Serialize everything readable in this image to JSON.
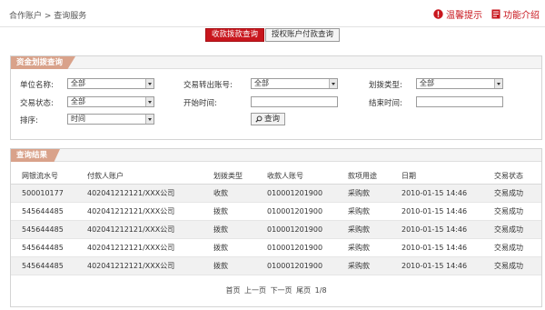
{
  "breadcrumb": {
    "text": "合作账户 > 查询服务"
  },
  "top_links": [
    {
      "label": "温馨提示",
      "icon": "alert-icon"
    },
    {
      "label": "功能介绍",
      "icon": "document-icon"
    }
  ],
  "tabs": [
    {
      "label": "收款拨款查询",
      "active": true
    },
    {
      "label": "授权账户付款查询",
      "active": false
    }
  ],
  "query_panel": {
    "title": "资金划拨查询",
    "unit_name_label": "单位名称:",
    "unit_name_value": "全部",
    "out_account_label": "交易转出账号:",
    "out_account_value": "全部",
    "transfer_type_label": "划拨类型:",
    "transfer_type_value": "全部",
    "status_label": "交易状态:",
    "status_value": "全部",
    "start_time_label": "开始时间:",
    "start_time_value": "",
    "end_time_label": "结束时间:",
    "end_time_value": "",
    "sort_label": "排序:",
    "sort_value": "时间",
    "query_button": "查询"
  },
  "results": {
    "title": "查询结果",
    "columns": [
      "网银流水号",
      "付款人账户",
      "划拨类型",
      "收款人账号",
      "款项用途",
      "日期",
      "交易状态"
    ],
    "rows": [
      [
        "500010177",
        "402041212121/XXX公司",
        "收款",
        "010001201900",
        "采购款",
        "2010-01-15 14:46",
        "交易成功"
      ],
      [
        "545644485",
        "402041212121/XXX公司",
        "拨款",
        "010001201900",
        "采购款",
        "2010-01-15 14:46",
        "交易成功"
      ],
      [
        "545644485",
        "402041212121/XXX公司",
        "拨款",
        "010001201900",
        "采购款",
        "2010-01-15 14:46",
        "交易成功"
      ],
      [
        "545644485",
        "402041212121/XXX公司",
        "拨款",
        "010001201900",
        "采购款",
        "2010-01-15 14:46",
        "交易成功"
      ],
      [
        "545644485",
        "402041212121/XXX公司",
        "拨款",
        "010001201900",
        "采购款",
        "2010-01-15 14:46",
        "交易成功"
      ]
    ],
    "pager": {
      "first": "首页",
      "prev": "上一页",
      "next": "下一页",
      "last": "尾页",
      "page_info": "1/8"
    }
  },
  "colors": {
    "accent": "#c8161d",
    "panel_title_bg": "#d9a28a",
    "even_row_bg": "#f1f1f1"
  }
}
